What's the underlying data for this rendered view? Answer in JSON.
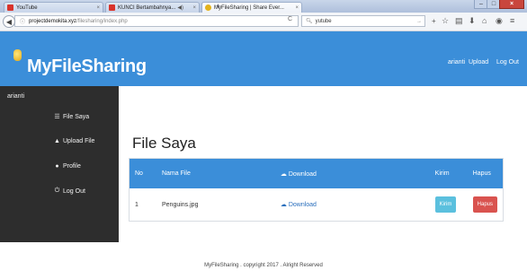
{
  "browser": {
    "tabs": [
      {
        "title": "YouTube",
        "favicon_color": "#d9332b",
        "active": false
      },
      {
        "title": "KUNCI Bertambahnya...",
        "favicon_color": "#d9332b",
        "active": false
      },
      {
        "title": "MyFileSharing | Share Ever...",
        "favicon_color": "#e3b21c",
        "active": true
      }
    ],
    "url_host": "projectdemokita.xyz",
    "url_path": "/filesharing/index.php",
    "search_value": "yutube",
    "close_glyph": "×",
    "new_tab_glyph": "+",
    "window_controls": {
      "minimize": "–",
      "maximize": "□",
      "close": "×"
    },
    "toolbar_icons": [
      "star-icon",
      "clipboard-icon",
      "download-icon",
      "home-icon",
      "pocket-icon",
      "menu-icon"
    ]
  },
  "header": {
    "brand": "MyFileSharing",
    "user": "arianti",
    "upload": "Upload",
    "logout": "Log Out",
    "color": "#3b8ed9"
  },
  "sidebar": {
    "user": "arianti",
    "items": [
      {
        "label": "File Saya",
        "icon": "list-icon"
      },
      {
        "label": "Upload File",
        "icon": "upload-icon"
      },
      {
        "label": "Profile",
        "icon": "user-icon"
      },
      {
        "label": "Log Out",
        "icon": "logout-icon"
      }
    ]
  },
  "main": {
    "title": "File Saya",
    "columns": [
      "No",
      "Nama File",
      "Download",
      "Kirim",
      "Hapus"
    ],
    "rows": [
      {
        "no": "1",
        "name": "Penguins.jpg",
        "download": "Download",
        "kirim": "Kirim",
        "hapus": "Hapus"
      }
    ]
  },
  "footer": {
    "text": "MyFileSharing . copyright 2017 . Alright Reserved"
  },
  "colors": {
    "kirim": "#5bc0de",
    "hapus": "#d9534f",
    "sidebar": "#2d2d2d"
  }
}
